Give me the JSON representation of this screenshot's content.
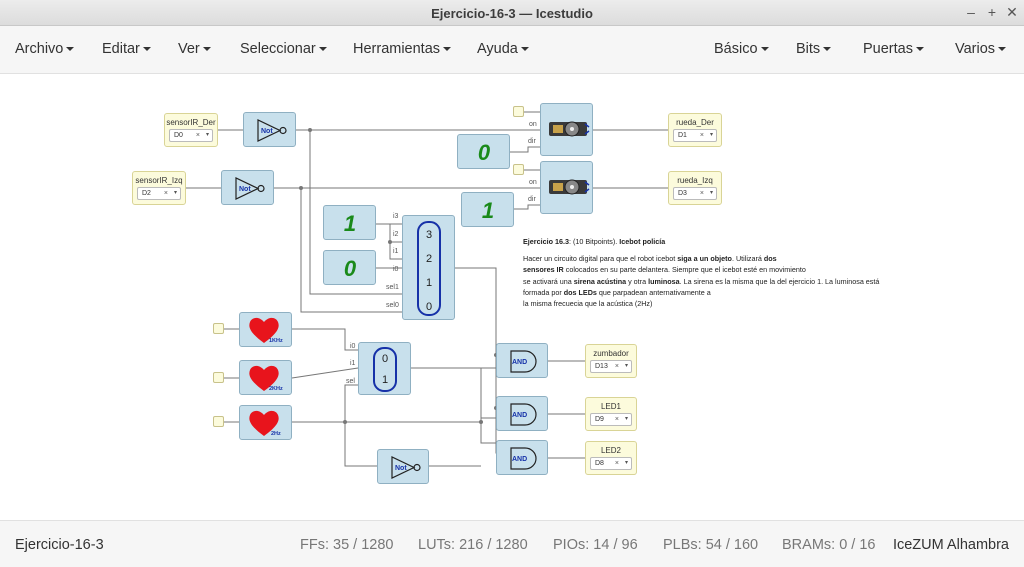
{
  "window": {
    "title": "Ejercicio-16-3 — Icestudio"
  },
  "menus_left": [
    "Archivo",
    "Editar",
    "Ver",
    "Seleccionar",
    "Herramientas",
    "Ayuda"
  ],
  "menus_right": [
    "Básico",
    "Bits",
    "Puertas",
    "Varios"
  ],
  "inputs": [
    {
      "name": "sensorIR_Der",
      "pin": "D0"
    },
    {
      "name": "sensorIR_Izq",
      "pin": "D2"
    }
  ],
  "outputs": [
    {
      "name": "rueda_Der",
      "pin": "D1"
    },
    {
      "name": "rueda_Izq",
      "pin": "D3"
    },
    {
      "name": "zumbador",
      "pin": "D13"
    },
    {
      "name": "LED1",
      "pin": "D9"
    },
    {
      "name": "LED2",
      "pin": "D8"
    }
  ],
  "constants": [
    "0",
    "1",
    "1",
    "0"
  ],
  "gates": {
    "not": "Not",
    "and": "AND"
  },
  "heart_labels": [
    "1KHz",
    "2KHz",
    "2Hz"
  ],
  "servo_ports": {
    "on": "on",
    "dir": "dir"
  },
  "mux4": {
    "ports": [
      "i3",
      "i2",
      "i1",
      "i0",
      "sel1",
      "sel0"
    ],
    "values": [
      "3",
      "2",
      "1",
      "0"
    ]
  },
  "mux2": {
    "ports": [
      "i0",
      "i1",
      "sel"
    ],
    "values": [
      "0",
      "1"
    ]
  },
  "note": {
    "t1": "Ejercicio 16.3",
    "t2": ": (10 Bitpoints).",
    "t3": "Icebot policía",
    "l1a": "Hacer un circuito digital para que el robot icebot ",
    "l1b": "siga a un objeto",
    "l1c": ". Utilizará ",
    "l1d": "dos",
    "l2a": "sensores IR",
    "l2b": " colocados en su parte delantera. Siempre que el icebot esté en movimiento",
    "l3a": "se activará una ",
    "l3b": "sirena acústina",
    "l3c": " y otra ",
    "l3d": "luminosa",
    "l3e": ". La sirena es la misma que la del ejercicio 1. La luminosa está",
    "l4a": "formada por ",
    "l4b": "dos LEDs",
    "l4c": " que parpadean anternativamente a",
    "l5": "la misma frecuecia que la acústica (2Hz)"
  },
  "footer": {
    "project": "Ejercicio-16-3",
    "ffs": "FFs:  35 / 1280",
    "luts": "LUTs:  216 / 1280",
    "pios": "PIOs:  14 / 96",
    "plbs": "PLBs:  54 / 160",
    "brams": "BRAMs:  0 / 16",
    "board": "IceZUM Alhambra"
  },
  "colors": {
    "block": "#c8e0ec",
    "io": "#fcfbdc",
    "wire": "#777777",
    "accent": "#1631a8",
    "heart": "#e8141c",
    "const": "#1a8a1a"
  }
}
